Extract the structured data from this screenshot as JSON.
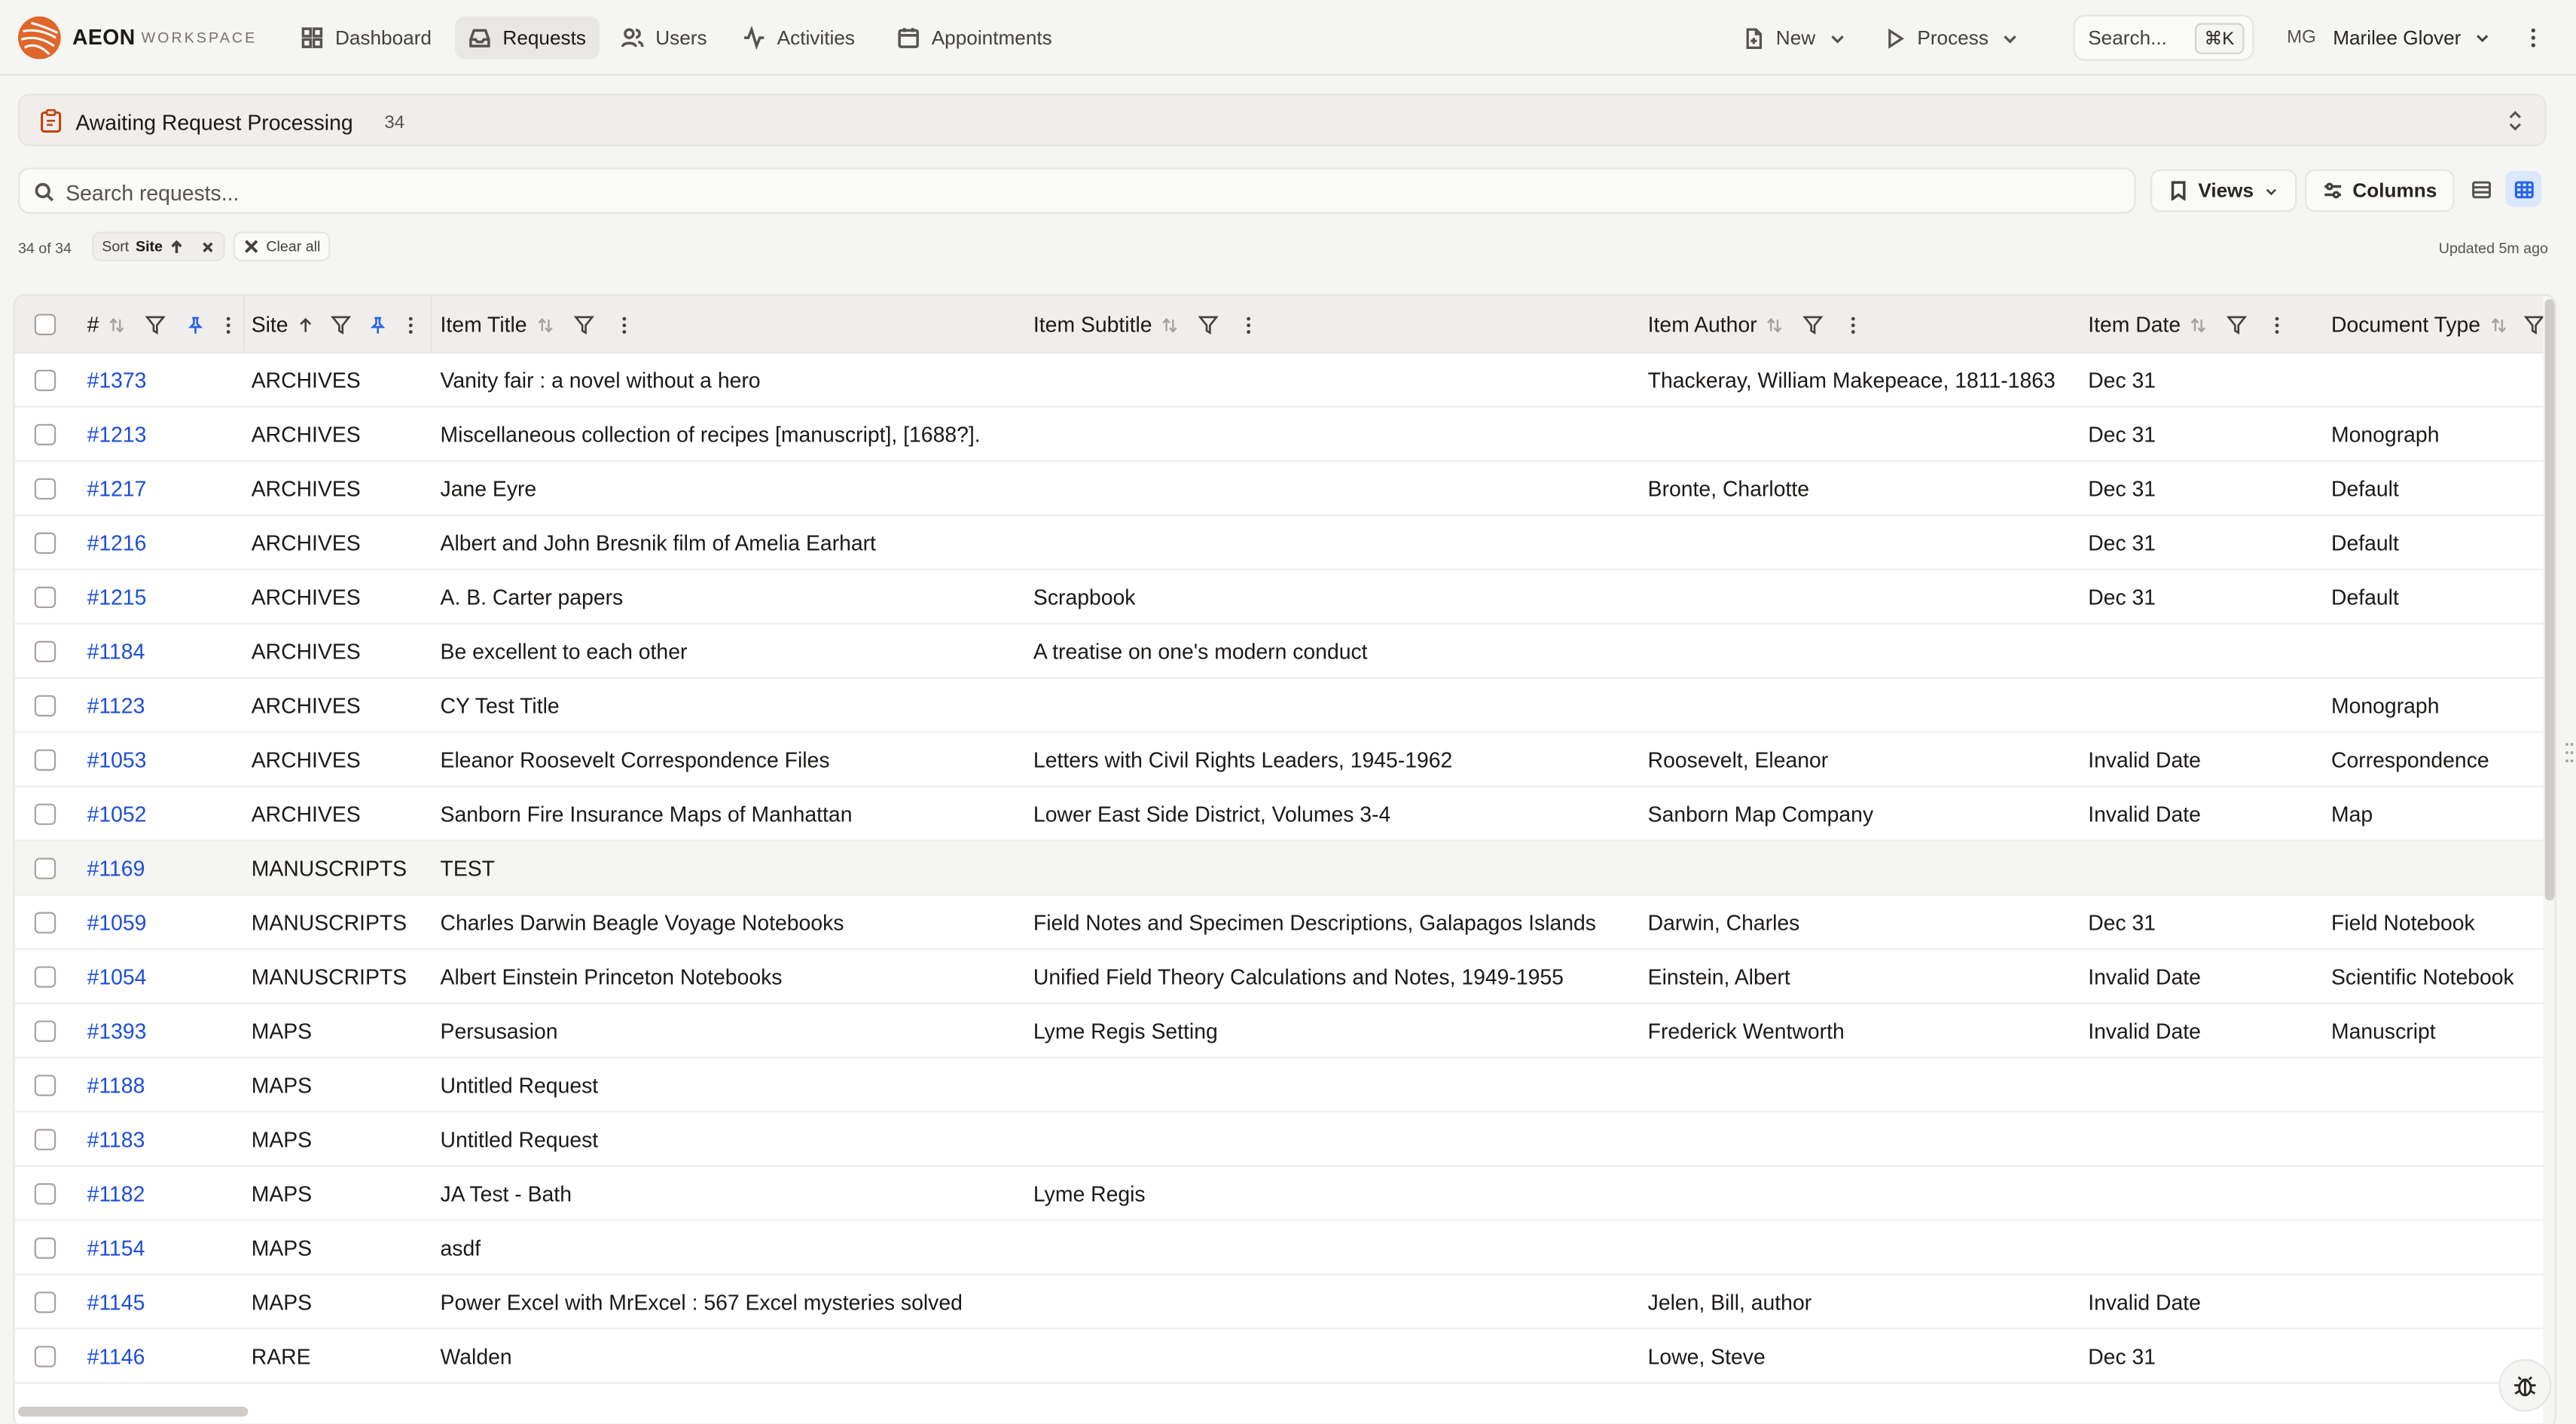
{
  "brand": {
    "name": "AEON",
    "sub": "WORKSPACE",
    "accent": "#e0662b"
  },
  "nav": {
    "items": [
      {
        "label": "Dashboard",
        "icon": "grid-icon"
      },
      {
        "label": "Requests",
        "icon": "inbox-icon",
        "active": true
      },
      {
        "label": "Users",
        "icon": "users-icon"
      },
      {
        "label": "Activities",
        "icon": "activity-icon"
      },
      {
        "label": "Appointments",
        "icon": "calendar-icon"
      }
    ],
    "new_label": "New",
    "process_label": "Process",
    "search_label": "Search...",
    "search_shortcut": "⌘K",
    "user_initials": "MG",
    "user_name": "Marilee Glover"
  },
  "queue": {
    "title": "Awaiting Request Processing",
    "count": "34"
  },
  "search": {
    "placeholder": "Search requests..."
  },
  "toolbar": {
    "views_label": "Views",
    "columns_label": "Columns"
  },
  "filters": {
    "count_text": "34 of 34",
    "sort_prefix": "Sort",
    "sort_field": "Site",
    "clear_label": "Clear all",
    "updated_text": "Updated 5m ago"
  },
  "table": {
    "columns": {
      "id": "#",
      "site": "Site",
      "title": "Item Title",
      "subtitle": "Item Subtitle",
      "author": "Item Author",
      "date": "Item Date",
      "doctype": "Document Type"
    },
    "rows": [
      {
        "id": "#1373",
        "site": "ARCHIVES",
        "title": "Vanity fair : a novel without a hero",
        "subtitle": "",
        "author": "Thackeray, William Makepeace, 1811-1863",
        "date": "Dec 31",
        "doctype": ""
      },
      {
        "id": "#1213",
        "site": "ARCHIVES",
        "title": "Miscellaneous collection of recipes [manuscript], [1688?].",
        "subtitle": "",
        "author": "",
        "date": "Dec 31",
        "doctype": "Monograph"
      },
      {
        "id": "#1217",
        "site": "ARCHIVES",
        "title": "Jane Eyre",
        "subtitle": "",
        "author": "Bronte, Charlotte",
        "date": "Dec 31",
        "doctype": "Default"
      },
      {
        "id": "#1216",
        "site": "ARCHIVES",
        "title": "Albert and John Bresnik film of Amelia Earhart",
        "subtitle": "",
        "author": "",
        "date": "Dec 31",
        "doctype": "Default"
      },
      {
        "id": "#1215",
        "site": "ARCHIVES",
        "title": "A. B. Carter papers",
        "subtitle": "Scrapbook",
        "author": "",
        "date": "Dec 31",
        "doctype": "Default"
      },
      {
        "id": "#1184",
        "site": "ARCHIVES",
        "title": "Be excellent to each other",
        "subtitle": "A treatise on one's modern conduct",
        "author": "",
        "date": "",
        "doctype": ""
      },
      {
        "id": "#1123",
        "site": "ARCHIVES",
        "title": "CY Test Title",
        "subtitle": "",
        "author": "",
        "date": "",
        "doctype": "Monograph"
      },
      {
        "id": "#1053",
        "site": "ARCHIVES",
        "title": "Eleanor Roosevelt Correspondence Files",
        "subtitle": "Letters with Civil Rights Leaders, 1945-1962",
        "author": "Roosevelt, Eleanor",
        "date": "Invalid Date",
        "doctype": "Correspondence"
      },
      {
        "id": "#1052",
        "site": "ARCHIVES",
        "title": "Sanborn Fire Insurance Maps of Manhattan",
        "subtitle": "Lower East Side District, Volumes 3-4",
        "author": "Sanborn Map Company",
        "date": "Invalid Date",
        "doctype": "Map"
      },
      {
        "id": "#1169",
        "site": "MANUSCRIPTS",
        "title": "TEST",
        "subtitle": "",
        "author": "",
        "date": "",
        "doctype": "",
        "hl": true
      },
      {
        "id": "#1059",
        "site": "MANUSCRIPTS",
        "title": "Charles Darwin Beagle Voyage Notebooks",
        "subtitle": "Field Notes and Specimen Descriptions, Galapagos Islands",
        "author": "Darwin, Charles",
        "date": "Dec 31",
        "doctype": "Field Notebook"
      },
      {
        "id": "#1054",
        "site": "MANUSCRIPTS",
        "title": "Albert Einstein Princeton Notebooks",
        "subtitle": "Unified Field Theory Calculations and Notes, 1949-1955",
        "author": "Einstein, Albert",
        "date": "Invalid Date",
        "doctype": "Scientific Notebook"
      },
      {
        "id": "#1393",
        "site": "MAPS",
        "title": "Persusasion",
        "subtitle": "Lyme Regis Setting",
        "author": "Frederick Wentworth",
        "date": "Invalid Date",
        "doctype": "Manuscript"
      },
      {
        "id": "#1188",
        "site": "MAPS",
        "title": "Untitled Request",
        "subtitle": "",
        "author": "",
        "date": "",
        "doctype": ""
      },
      {
        "id": "#1183",
        "site": "MAPS",
        "title": "Untitled Request",
        "subtitle": "",
        "author": "",
        "date": "",
        "doctype": ""
      },
      {
        "id": "#1182",
        "site": "MAPS",
        "title": "JA Test - Bath",
        "subtitle": "Lyme Regis",
        "author": "",
        "date": "",
        "doctype": ""
      },
      {
        "id": "#1154",
        "site": "MAPS",
        "title": "asdf",
        "subtitle": "",
        "author": "",
        "date": "",
        "doctype": ""
      },
      {
        "id": "#1145",
        "site": "MAPS",
        "title": "Power Excel with MrExcel : 567 Excel mysteries solved",
        "subtitle": "",
        "author": "Jelen, Bill, author",
        "date": "Invalid Date",
        "doctype": ""
      },
      {
        "id": "#1146",
        "site": "RARE",
        "title": "Walden",
        "subtitle": "",
        "author": "Lowe, Steve",
        "date": "Dec 31",
        "doctype": ""
      }
    ]
  }
}
